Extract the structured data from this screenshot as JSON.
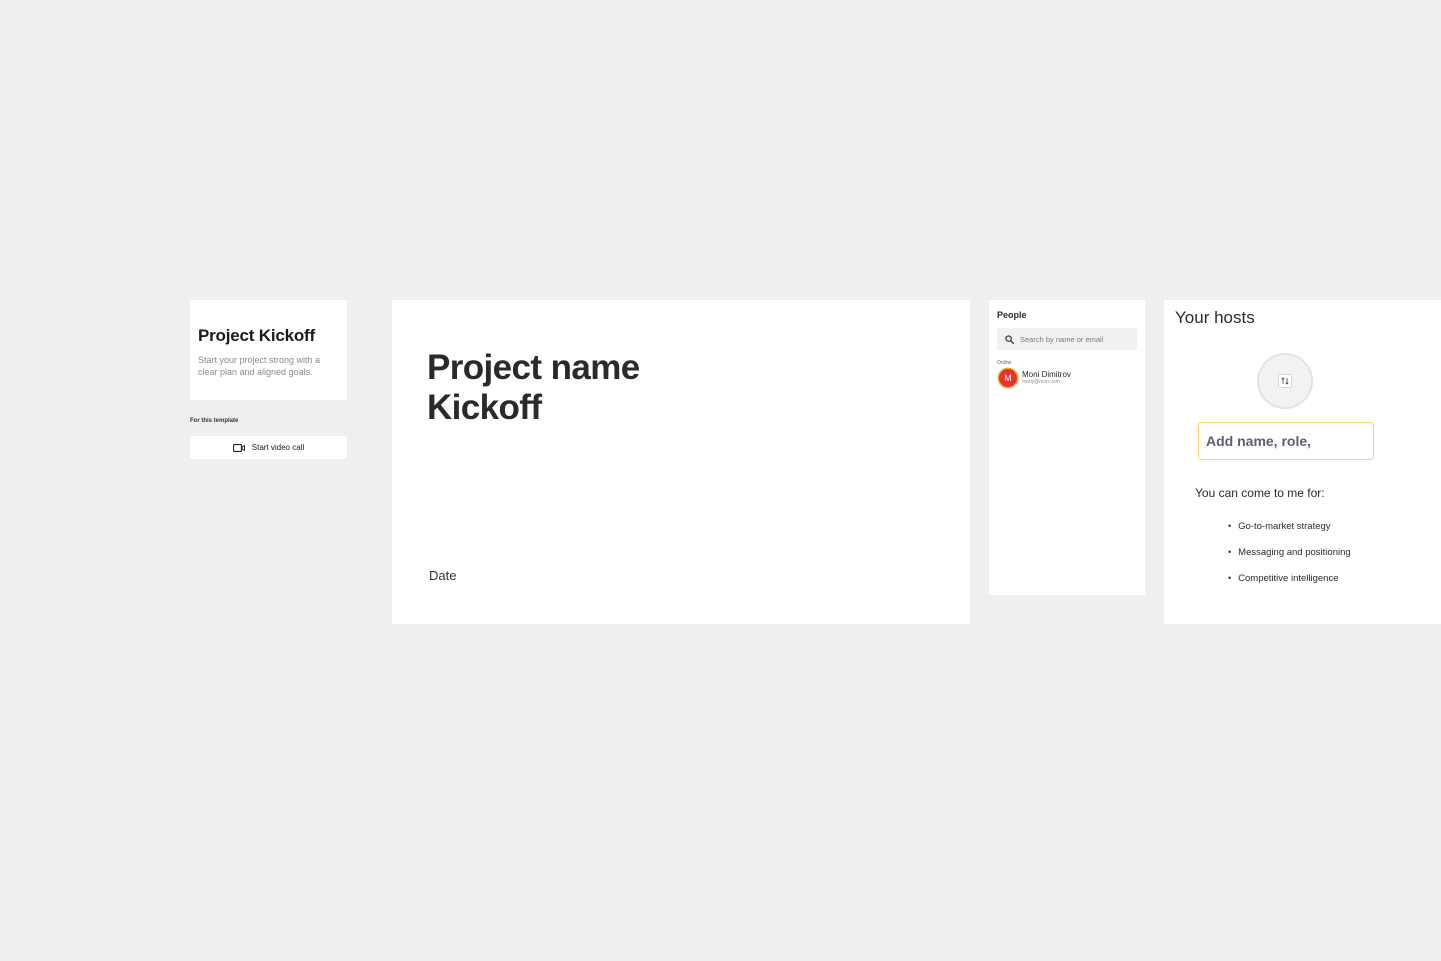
{
  "info_card": {
    "title": "Project Kickoff",
    "description": "Start your project strong with a clear plan and aligned goals."
  },
  "template_actions": {
    "section_label": "For this template",
    "video_call_label": "Start video call",
    "video_icon": "video-camera-icon"
  },
  "slide": {
    "title_line1": "Project name",
    "title_line2": "Kickoff",
    "date_label": "Date"
  },
  "people": {
    "title": "People",
    "search_placeholder": "Search by name or email",
    "search_icon": "search-icon",
    "online_label": "Online",
    "members": [
      {
        "initial": "M",
        "name": "Moni Dimitrov",
        "email": "mony@miro.com",
        "avatar_color": "#e8322f",
        "ring_color": "#f6b03a"
      }
    ]
  },
  "hosts": {
    "title": "Your hosts",
    "photo_upload_icon": "swap-icon",
    "name_placeholder": "Add name, role,",
    "come_to_me_label": "You can come to me for:",
    "topics": [
      "Go-to-market strategy",
      "Messaging and positioning",
      "Competitive intelligence"
    ]
  },
  "colors": {
    "canvas": "#efefef",
    "card": "#ffffff",
    "name_box_border": "#f5d867"
  }
}
